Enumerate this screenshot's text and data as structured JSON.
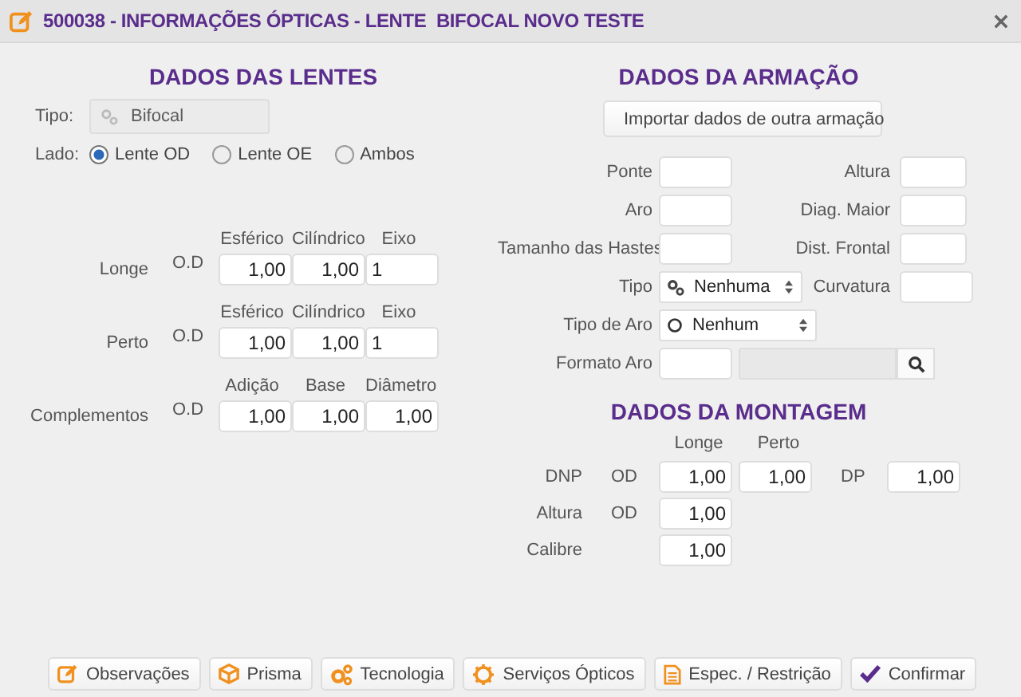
{
  "window": {
    "title": "500038 - INFORMAÇÕES ÓPTICAS - LENTE  BIFOCAL NOVO TESTE"
  },
  "lenses": {
    "heading": "DADOS DAS LENTES",
    "tipo": {
      "label": "Tipo:",
      "value": "Bifocal",
      "disabled": true
    },
    "lado": {
      "label": "Lado:",
      "options": [
        {
          "label": "Lente OD",
          "selected": true
        },
        {
          "label": "Lente OE",
          "selected": false
        },
        {
          "label": "Ambos",
          "selected": false
        }
      ]
    },
    "groups": [
      {
        "label": "Longe",
        "eye": "O.D",
        "columns": [
          "Esférico",
          "Cilíndrico",
          "Eixo"
        ],
        "values": [
          {
            "value": "1,00",
            "kind": "decimal"
          },
          {
            "value": "1,00",
            "kind": "decimal"
          },
          {
            "value": "1",
            "kind": "integer"
          }
        ]
      },
      {
        "label": "Perto",
        "eye": "O.D",
        "columns": [
          "Esférico",
          "Cilíndrico",
          "Eixo"
        ],
        "values": [
          {
            "value": "1,00",
            "kind": "decimal"
          },
          {
            "value": "1,00",
            "kind": "decimal"
          },
          {
            "value": "1",
            "kind": "integer"
          }
        ]
      },
      {
        "label": "Complementos",
        "eye": "O.D",
        "columns": [
          "Adição",
          "Base",
          "Diâmetro"
        ],
        "values": [
          {
            "value": "1,00",
            "kind": "decimal"
          },
          {
            "value": "1,00",
            "kind": "decimal"
          },
          {
            "value": "1,00",
            "kind": "decimal"
          }
        ]
      }
    ]
  },
  "frame": {
    "heading": "DADOS DA ARMAÇÃO",
    "import_button": "Importar dados de outra armação",
    "rows": [
      {
        "left": {
          "label": "Ponte",
          "kind": "input"
        },
        "right": {
          "label": "Altura",
          "kind": "input"
        }
      },
      {
        "left": {
          "label": "Aro",
          "kind": "input"
        },
        "right": {
          "label": "Diag. Maior",
          "kind": "input"
        }
      },
      {
        "left": {
          "label": "Tamanho das Hastes",
          "kind": "input"
        },
        "right": {
          "label": "Dist. Frontal",
          "kind": "input"
        }
      },
      {
        "left": {
          "label": "Tipo",
          "kind": "select",
          "value": "Nenhuma"
        },
        "right": {
          "label": "Curvatura",
          "kind": "input"
        }
      },
      {
        "left": {
          "label": "Tipo de Aro",
          "kind": "select",
          "value": "Nenhum"
        }
      },
      {
        "left": {
          "label": "Formato Aro",
          "kind": "lookup",
          "disabled": true
        }
      }
    ]
  },
  "mounting": {
    "heading": "DADOS DA MONTAGEM",
    "columns": [
      "Longe",
      "Perto"
    ],
    "rows": [
      {
        "label": "DNP",
        "eye": "OD",
        "values": [
          "1,00",
          "1,00"
        ],
        "extra": {
          "label": "DP",
          "value": "1,00"
        }
      },
      {
        "label": "Altura",
        "eye": "OD",
        "values": [
          "1,00"
        ]
      },
      {
        "label": "Calibre",
        "values": [
          "1,00"
        ]
      }
    ]
  },
  "buttons": [
    {
      "label": "Observações"
    },
    {
      "label": "Prisma"
    },
    {
      "label": "Tecnologia"
    },
    {
      "label": "Serviços Ópticos"
    },
    {
      "label": "Espec. / Restrição"
    },
    {
      "label": "Confirmar"
    }
  ]
}
